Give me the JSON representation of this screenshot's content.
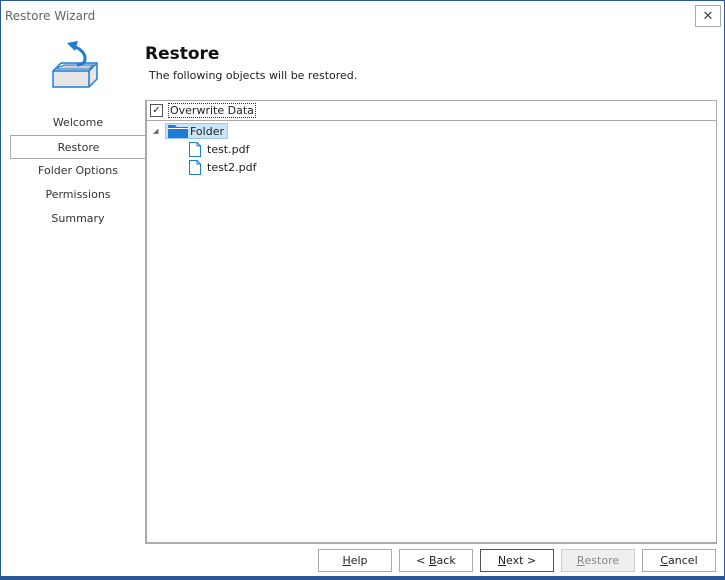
{
  "window": {
    "title": "Restore Wizard",
    "close_label": "✕"
  },
  "header": {
    "title": "Restore",
    "subtitle": "The following objects will be restored."
  },
  "nav": {
    "items": [
      {
        "label": "Welcome",
        "active": false
      },
      {
        "label": "Restore",
        "active": true
      },
      {
        "label": "Folder Options",
        "active": false
      },
      {
        "label": "Permissions",
        "active": false
      },
      {
        "label": "Summary",
        "active": false
      }
    ]
  },
  "tree": {
    "header_checked": true,
    "header_checkmark": "✓",
    "header_label": "Overwrite Data",
    "expander": "◢",
    "folder": {
      "label": "Folder",
      "icon": "folder-icon"
    },
    "files": [
      {
        "label": "test.pdf",
        "icon": "file-icon"
      },
      {
        "label": "test2.pdf",
        "icon": "file-icon"
      }
    ]
  },
  "buttons": {
    "help": {
      "mnemonic": "H",
      "rest": "elp"
    },
    "back": {
      "pre": "< ",
      "mnemonic": "B",
      "rest": "ack"
    },
    "next": {
      "mnemonic": "N",
      "rest": "ext >"
    },
    "restore": {
      "mnemonic": "R",
      "rest": "estore",
      "disabled": true
    },
    "cancel": {
      "mnemonic": "C",
      "rest": "ancel"
    }
  },
  "colors": {
    "accent": "#2b5797",
    "icon_blue": "#1e7bd6",
    "selection": "#cce4f7"
  }
}
